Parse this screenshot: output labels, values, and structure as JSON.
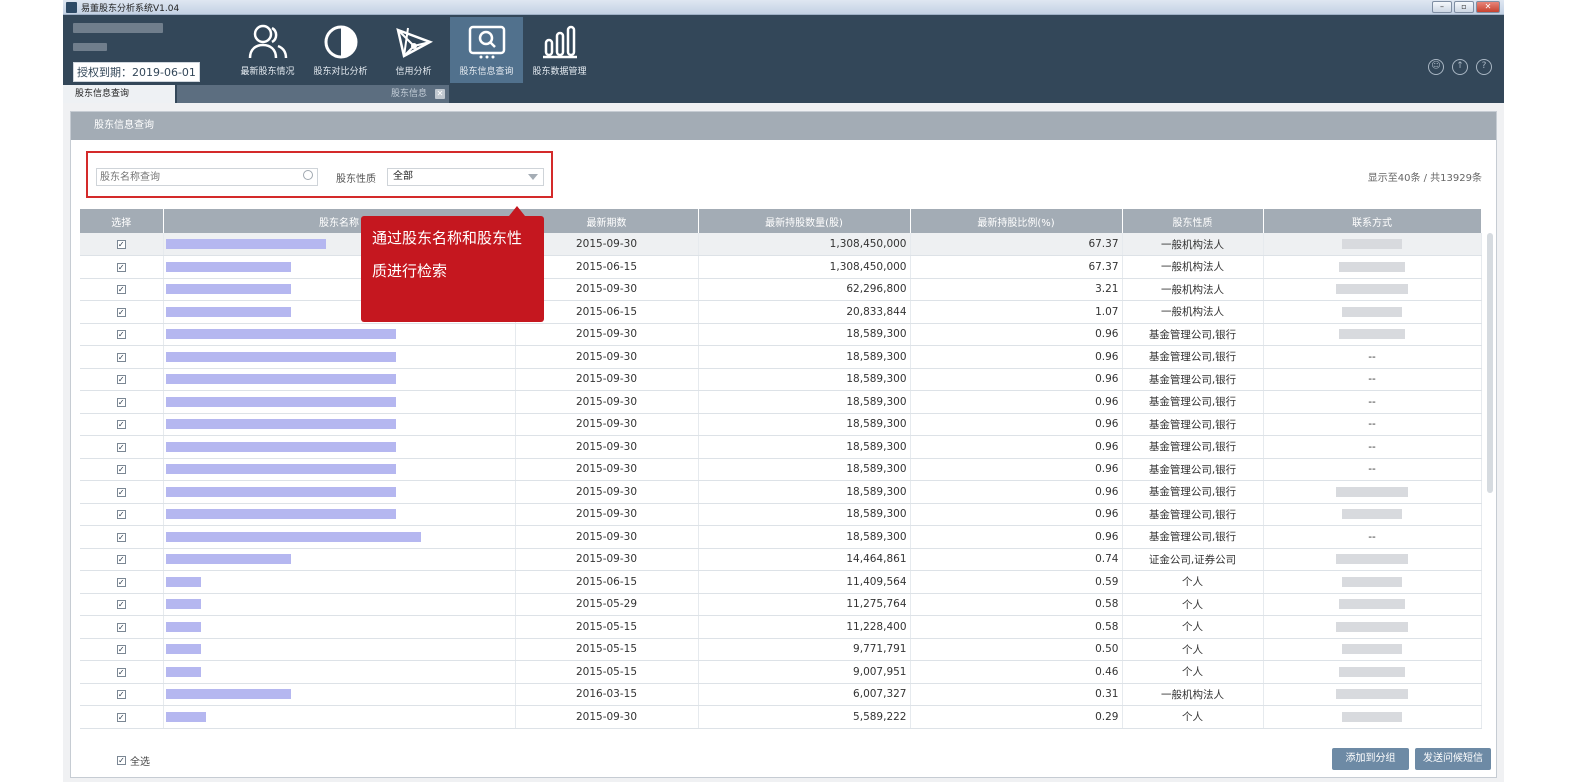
{
  "window": {
    "title": "易董股东分析系统V1.04",
    "buttons": [
      "–",
      "▫",
      "✕"
    ]
  },
  "header": {
    "license": "授权到期：2019-06-01",
    "nav": [
      {
        "label": "最新股东情况",
        "icon": "users-icon"
      },
      {
        "label": "股东对比分析",
        "icon": "half-circle-icon"
      },
      {
        "label": "信用分析",
        "icon": "network-icon"
      },
      {
        "label": "股东信息查询",
        "icon": "search-screen-icon",
        "active": true
      },
      {
        "label": "股东数据管理",
        "icon": "bar-chart-icon"
      }
    ],
    "icons": [
      "user-icon",
      "upload-icon",
      "help-icon"
    ]
  },
  "tabs": {
    "active": "股东信息查询",
    "second": "股东信息"
  },
  "panel": {
    "title": "股东信息查询",
    "search_placeholder": "股东名称查询",
    "type_label": "股东性质",
    "type_value": "全部",
    "count": "显示至40条 / 共13929条"
  },
  "table": {
    "columns": [
      "选择",
      "股东名称",
      "最新期数",
      "最新持股数量(股)",
      "最新持股比例(%)",
      "股东性质",
      "联系方式"
    ],
    "rows": [
      {
        "date": "2015-09-30",
        "shares": "1,308,450,000",
        "ratio": "67.37",
        "type": "一般机构法人",
        "contact": ""
      },
      {
        "date": "2015-06-15",
        "shares": "1,308,450,000",
        "ratio": "67.37",
        "type": "一般机构法人",
        "contact": ""
      },
      {
        "date": "2015-09-30",
        "shares": "62,296,800",
        "ratio": "3.21",
        "type": "一般机构法人",
        "contact": ""
      },
      {
        "date": "2015-06-15",
        "shares": "20,833,844",
        "ratio": "1.07",
        "type": "一般机构法人",
        "contact": ""
      },
      {
        "date": "2015-09-30",
        "shares": "18,589,300",
        "ratio": "0.96",
        "type": "基金管理公司,银行",
        "contact": ""
      },
      {
        "date": "2015-09-30",
        "shares": "18,589,300",
        "ratio": "0.96",
        "type": "基金管理公司,银行",
        "contact": "--"
      },
      {
        "date": "2015-09-30",
        "shares": "18,589,300",
        "ratio": "0.96",
        "type": "基金管理公司,银行",
        "contact": "--"
      },
      {
        "date": "2015-09-30",
        "shares": "18,589,300",
        "ratio": "0.96",
        "type": "基金管理公司,银行",
        "contact": "--"
      },
      {
        "date": "2015-09-30",
        "shares": "18,589,300",
        "ratio": "0.96",
        "type": "基金管理公司,银行",
        "contact": "--"
      },
      {
        "date": "2015-09-30",
        "shares": "18,589,300",
        "ratio": "0.96",
        "type": "基金管理公司,银行",
        "contact": "--"
      },
      {
        "date": "2015-09-30",
        "shares": "18,589,300",
        "ratio": "0.96",
        "type": "基金管理公司,银行",
        "contact": "--"
      },
      {
        "date": "2015-09-30",
        "shares": "18,589,300",
        "ratio": "0.96",
        "type": "基金管理公司,银行",
        "contact": ""
      },
      {
        "date": "2015-09-30",
        "shares": "18,589,300",
        "ratio": "0.96",
        "type": "基金管理公司,银行",
        "contact": ""
      },
      {
        "date": "2015-09-30",
        "shares": "18,589,300",
        "ratio": "0.96",
        "type": "基金管理公司,银行",
        "contact": "--"
      },
      {
        "date": "2015-09-30",
        "shares": "14,464,861",
        "ratio": "0.74",
        "type": "证金公司,证券公司",
        "contact": ""
      },
      {
        "date": "2015-06-15",
        "shares": "11,409,564",
        "ratio": "0.59",
        "type": "个人",
        "contact": ""
      },
      {
        "date": "2015-05-29",
        "shares": "11,275,764",
        "ratio": "0.58",
        "type": "个人",
        "contact": ""
      },
      {
        "date": "2015-05-15",
        "shares": "11,228,400",
        "ratio": "0.58",
        "type": "个人",
        "contact": ""
      },
      {
        "date": "2015-05-15",
        "shares": "9,771,791",
        "ratio": "0.50",
        "type": "个人",
        "contact": ""
      },
      {
        "date": "2015-05-15",
        "shares": "9,007,951",
        "ratio": "0.46",
        "type": "个人",
        "contact": ""
      },
      {
        "date": "2016-03-15",
        "shares": "6,007,327",
        "ratio": "0.31",
        "type": "一般机构法人",
        "contact": ""
      },
      {
        "date": "2015-09-30",
        "shares": "5,589,222",
        "ratio": "0.29",
        "type": "个人",
        "contact": ""
      }
    ]
  },
  "callout": {
    "line1": "通过股东名称和股东性",
    "line2": "质进行检索"
  },
  "footer": {
    "select_all": "全选",
    "add_group": "添加到分组",
    "send_sms": "发送问候短信"
  }
}
